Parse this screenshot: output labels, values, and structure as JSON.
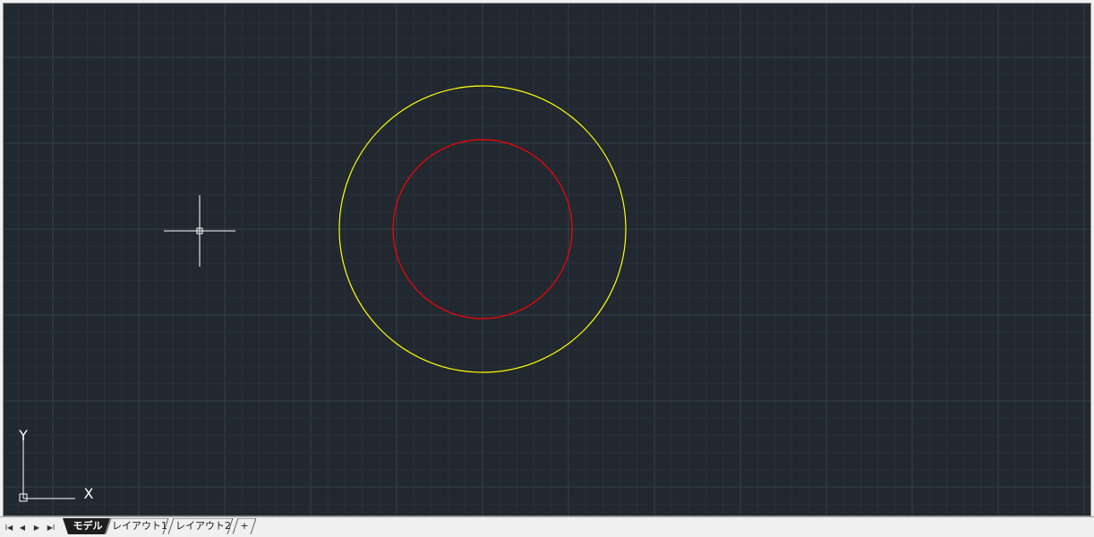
{
  "tabs": [
    {
      "label": "モデル",
      "active": true
    },
    {
      "label": "レイアウト1",
      "active": false
    },
    {
      "label": "レイアウト2",
      "active": false
    },
    {
      "label": "+",
      "active": false
    }
  ],
  "nav_buttons": [
    {
      "icon": "first-tab-icon",
      "glyph": "I◀"
    },
    {
      "icon": "prev-tab-icon",
      "glyph": "◀"
    },
    {
      "icon": "next-tab-icon",
      "glyph": "▶"
    },
    {
      "icon": "last-tab-icon",
      "glyph": "▶I"
    }
  ],
  "ucs": {
    "x_label": "X",
    "y_label": "Y"
  },
  "drawing": {
    "background": "#212830",
    "grid_minor_color": "#29313b",
    "grid_major_color": "#34404c",
    "circles": [
      {
        "name": "outer-circle",
        "color": "#ffff00"
      },
      {
        "name": "inner-circle",
        "color": "#ff0000"
      }
    ],
    "crosshair_color": "#ffffff"
  }
}
